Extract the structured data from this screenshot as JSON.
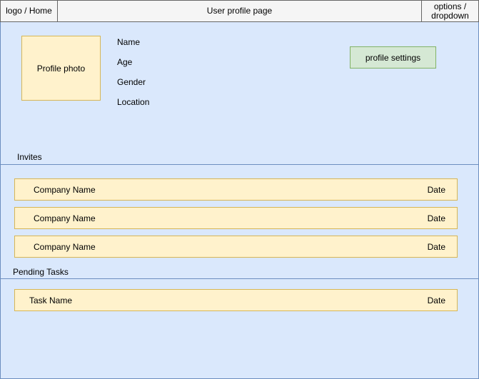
{
  "header": {
    "logo_label": "logo / Home",
    "title": "User profile page",
    "options_label": "options / dropdown"
  },
  "profile": {
    "photo_label": "Profile photo",
    "fields": [
      "Name",
      "Age",
      "Gender",
      "Location"
    ],
    "settings_label": "profile settings"
  },
  "invites": {
    "title": "Invites",
    "items": [
      {
        "company": "Company Name",
        "date": "Date"
      },
      {
        "company": "Company Name",
        "date": "Date"
      },
      {
        "company": "Company Name",
        "date": "Date"
      }
    ]
  },
  "tasks": {
    "title": "Pending Tasks",
    "items": [
      {
        "name": "Task Name",
        "date": "Date"
      }
    ]
  },
  "colors": {
    "panel_fill": "#dae8fc",
    "panel_stroke": "#6c8ebf",
    "card_fill": "#fff2cc",
    "card_stroke": "#d6b656",
    "button_fill": "#d5e8d4",
    "button_stroke": "#82b366",
    "header_fill": "#f5f5f5"
  }
}
